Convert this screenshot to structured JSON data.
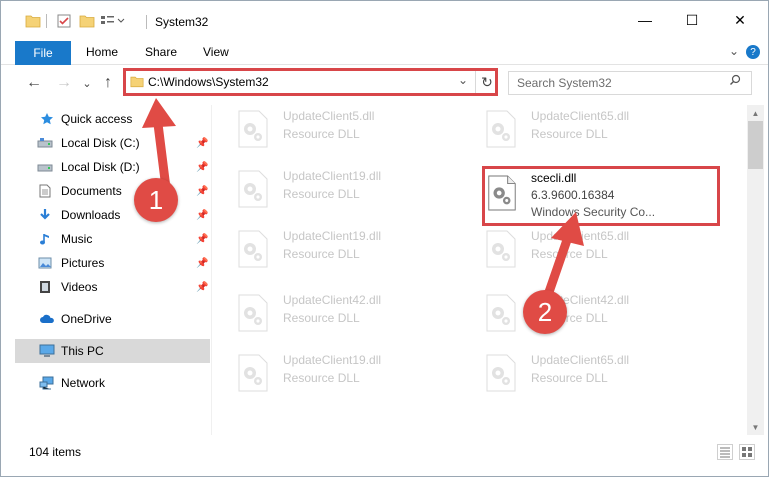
{
  "window": {
    "title": "System32",
    "buttons": {
      "minimize": "—",
      "maximize": "☐",
      "close": "✕"
    }
  },
  "ribbon": {
    "file_tab": "File",
    "tabs": [
      "Home",
      "Share",
      "View"
    ],
    "help": "?",
    "collapse": "⌄"
  },
  "nav": {
    "back": "←",
    "forward": "→",
    "recent": "⌄",
    "up": "↑"
  },
  "address": {
    "path": "C:\\Windows\\System32",
    "dropdown": "⌄",
    "refresh": "↻"
  },
  "search": {
    "placeholder": "Search System32",
    "icon": "search-icon"
  },
  "sidebar": {
    "quick_access": "Quick access",
    "pinned": [
      {
        "label": "Local Disk (C:)",
        "icon": "drive-icon"
      },
      {
        "label": "Local Disk (D:)",
        "icon": "drive-icon"
      },
      {
        "label": "Documents",
        "icon": "documents-icon"
      },
      {
        "label": "Downloads",
        "icon": "downloads-icon"
      },
      {
        "label": "Music",
        "icon": "music-icon"
      },
      {
        "label": "Pictures",
        "icon": "pictures-icon"
      },
      {
        "label": "Videos",
        "icon": "videos-icon"
      }
    ],
    "onedrive": "OneDrive",
    "this_pc": "This PC",
    "network": "Network"
  },
  "files": [
    {
      "name": "UpdateClient5.dll",
      "sub": "Resource DLL",
      "faded": true
    },
    {
      "name": "UpdateClient65.dll",
      "sub": "Resource DLL",
      "faded": true
    },
    {
      "name": "UpdateClient19.dll",
      "sub": "Resource DLL",
      "faded": true
    },
    {
      "name": "scecli.dll",
      "sub": "6.3.9600.16384",
      "sub2": "Windows Security Co...",
      "faded": false
    },
    {
      "name": "UpdateClient19.dll",
      "sub": "Resource DLL",
      "faded": true
    },
    {
      "name": "UpdateClient65.dll",
      "sub": "Resource DLL",
      "faded": true
    },
    {
      "name": "UpdateClient42.dll",
      "sub": "Resource DLL",
      "faded": true
    },
    {
      "name": "UpdateClient42.dll",
      "sub": "Resource DLL",
      "faded": true
    },
    {
      "name": "UpdateClient19.dll",
      "sub": "Resource DLL",
      "faded": true
    },
    {
      "name": "UpdateClient65.dll",
      "sub": "Resource DLL",
      "faded": true
    }
  ],
  "status": {
    "item_count": "104 items"
  },
  "annotations": {
    "callout_1": "1",
    "callout_2": "2",
    "color": "#e04b45"
  }
}
